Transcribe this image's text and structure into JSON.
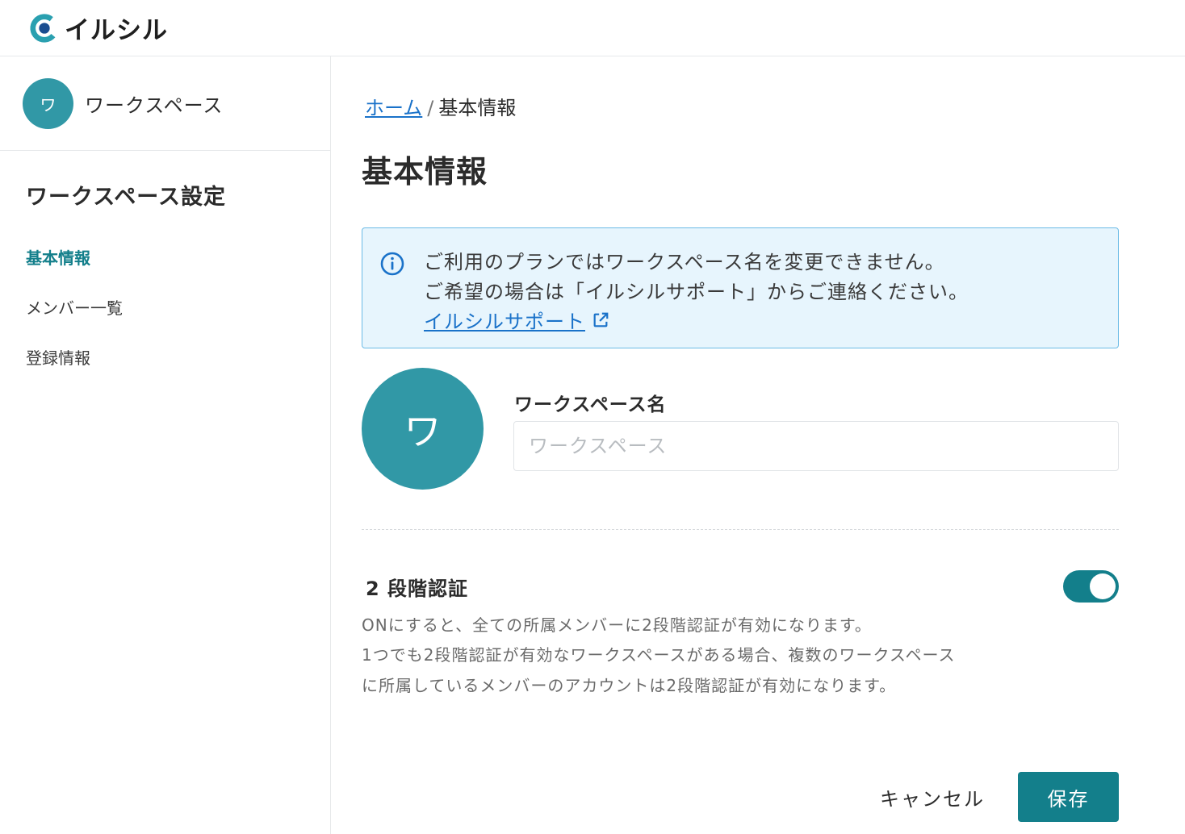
{
  "app": {
    "logo_text": "イルシル"
  },
  "sidebar": {
    "workspace_initial": "ワ",
    "workspace_name": "ワークスペース",
    "heading": "ワークスペース設定",
    "items": [
      {
        "label": "基本情報",
        "active": true
      },
      {
        "label": "メンバー一覧",
        "active": false
      },
      {
        "label": "登録情報",
        "active": false
      }
    ]
  },
  "breadcrumb": {
    "home": "ホーム",
    "separator": "/",
    "current": "基本情報"
  },
  "page": {
    "title": "基本情報"
  },
  "notice": {
    "line1": "ご利用のプランではワークスペース名を変更できません。",
    "line2": "ご希望の場合は「イルシルサポート」からご連絡ください。",
    "link": "イルシルサポート",
    "icon": "info-icon",
    "link_icon": "external-link-icon"
  },
  "workspace_form": {
    "avatar_initial": "ワ",
    "name_label": "ワークスペース名",
    "name_placeholder": "ワークスペース",
    "name_value": ""
  },
  "two_factor": {
    "title": "2 段階認証",
    "enabled": true,
    "desc1": "ONにすると、全ての所属メンバーに2段階認証が有効になります。",
    "desc2": "1つでも2段階認証が有効なワークスペースがある場合、複数のワークスペース",
    "desc3": "に所属しているメンバーのアカウントは2段階認証が有効になります。"
  },
  "actions": {
    "cancel": "キャンセル",
    "save": "保存"
  },
  "colors": {
    "accent": "#137f8b",
    "avatar": "#3198a6",
    "link": "#1a72c9",
    "notice_bg": "#e7f5fd",
    "notice_border": "#6bbbe6"
  }
}
